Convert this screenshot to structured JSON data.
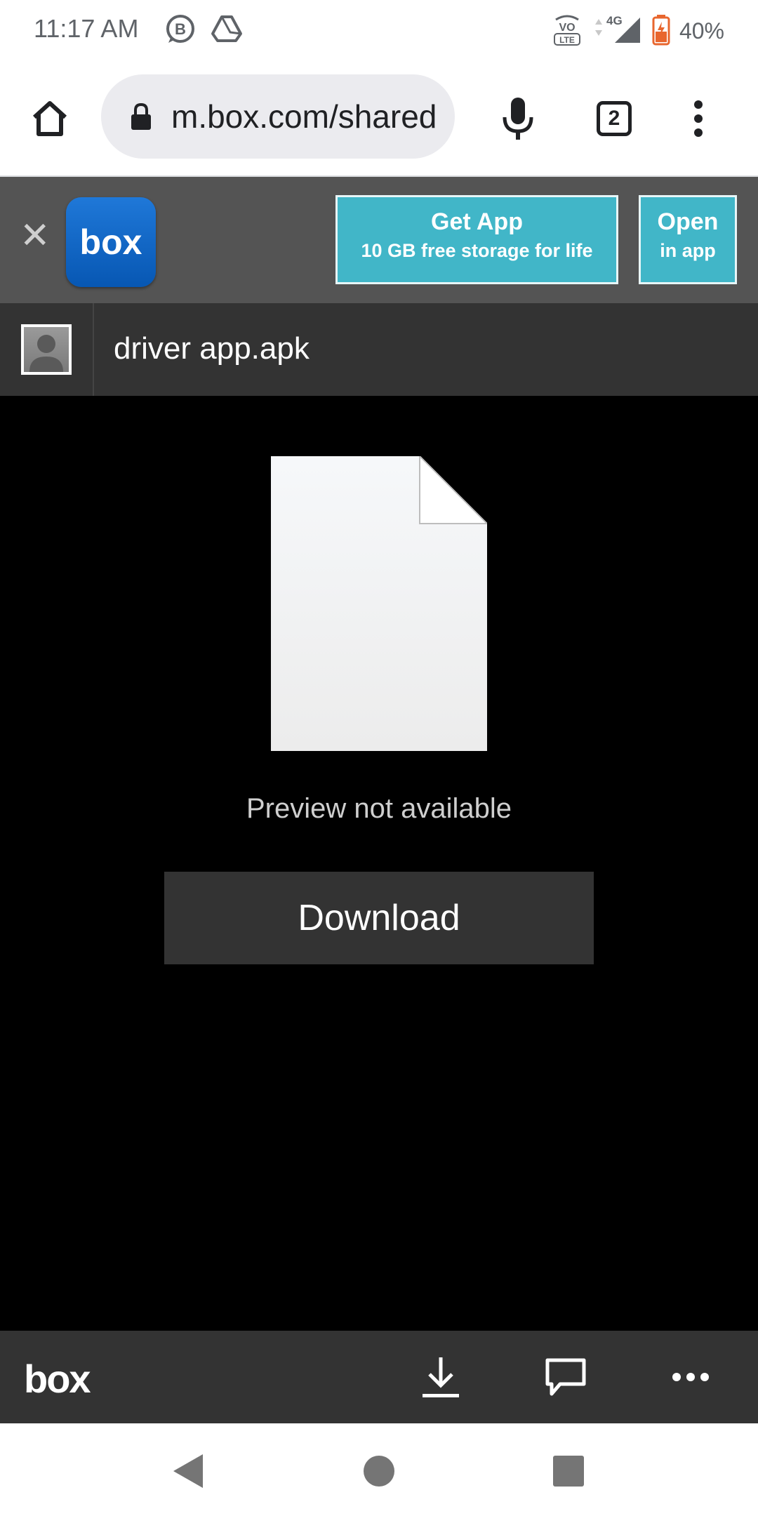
{
  "status_bar": {
    "time": "11:17 AM",
    "network": "4G",
    "battery": "40%",
    "icons": [
      "b-chat-icon",
      "drive-icon",
      "volte-icon",
      "signal-icon",
      "battery-icon"
    ]
  },
  "browser": {
    "url": "m.box.com/shared",
    "tab_count": "2",
    "icons": [
      "home-icon",
      "lock-icon",
      "mic-icon",
      "tabs-icon",
      "more-vert-icon"
    ]
  },
  "app_banner": {
    "close_label": "✕",
    "app_icon_text": "box",
    "get_app_title": "Get App",
    "get_app_subtitle": "10 GB free storage for life",
    "open_title": "Open",
    "open_subtitle": "in app",
    "accent_color": "#41b6c8"
  },
  "file": {
    "name": "driver app.apk"
  },
  "preview": {
    "message": "Preview not available",
    "download_label": "Download"
  },
  "box_bar": {
    "logo_text": "box",
    "icons": [
      "download-icon",
      "comment-icon",
      "more-horiz-icon"
    ]
  },
  "nav_bar": {
    "icons": [
      "back-icon",
      "home-circle-icon",
      "recents-icon"
    ]
  }
}
